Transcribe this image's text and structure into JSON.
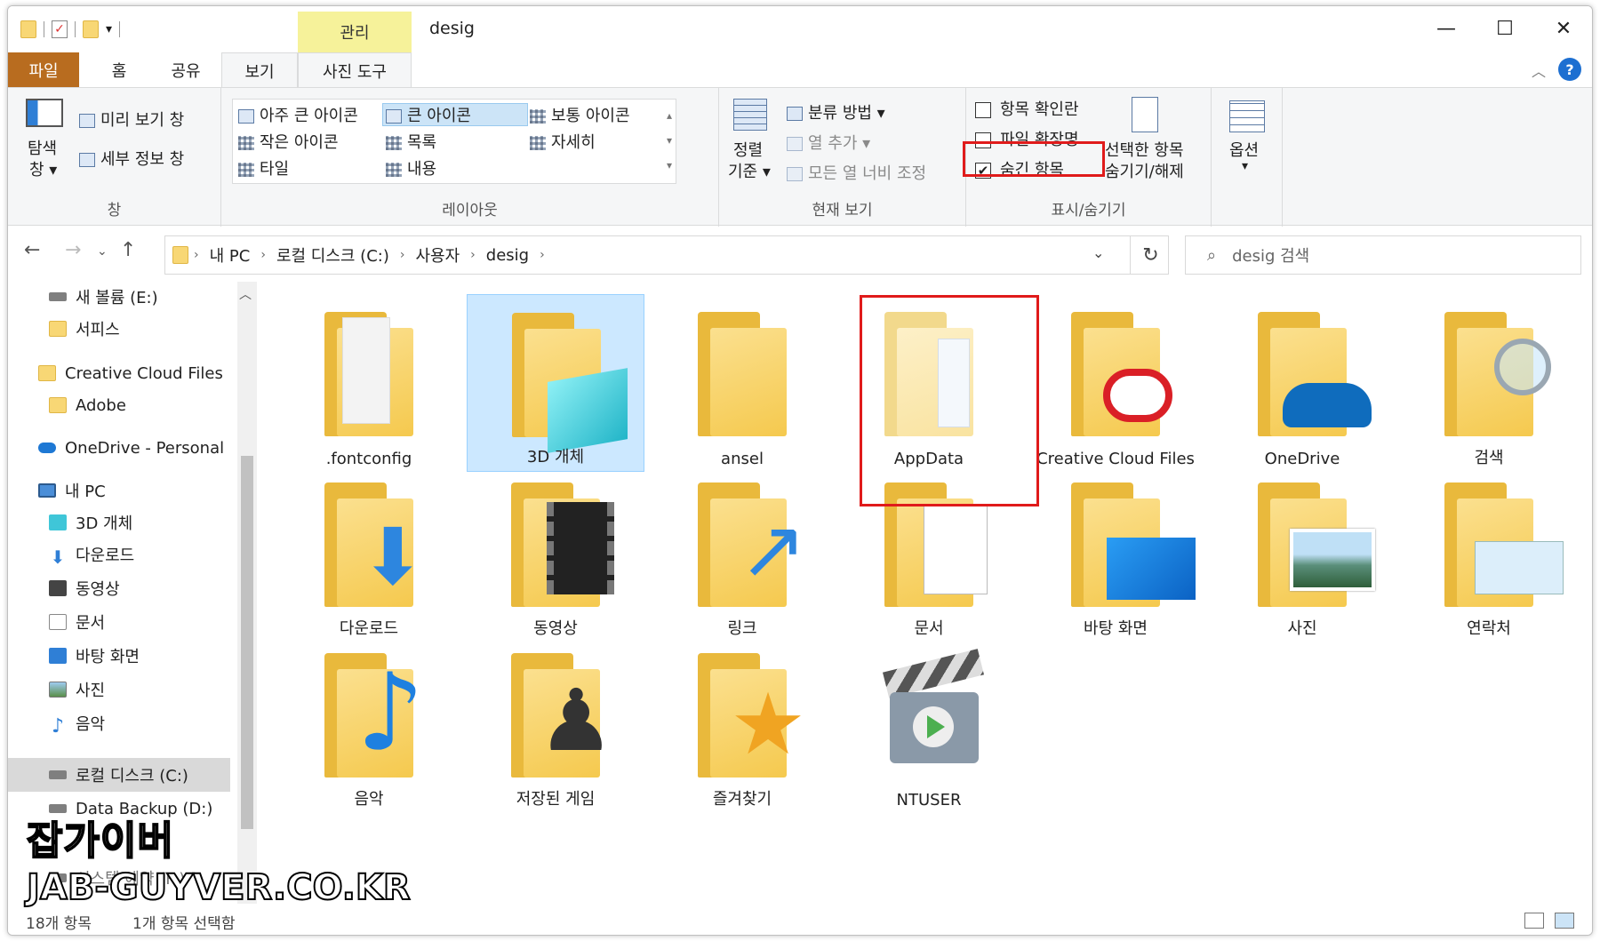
{
  "window": {
    "title": "desig",
    "manage_tab": "관리",
    "minimize": "—",
    "maximize": "☐",
    "close": "✕"
  },
  "tabs": {
    "file": "파일",
    "home": "홈",
    "share": "공유",
    "view": "보기",
    "photo_tools": "사진 도구"
  },
  "ribbon": {
    "pane": {
      "nav_pane": "탐색",
      "nav_pane2": "창 ▾",
      "preview": "미리 보기 창",
      "details": "세부 정보 창",
      "label": "창"
    },
    "layout": {
      "extra_large": "아주 큰 아이콘",
      "large": "큰 아이콘",
      "medium": "보통 아이콘",
      "small": "작은 아이콘",
      "list": "목록",
      "details": "자세히",
      "tiles": "타일",
      "content": "내용",
      "label": "레이아웃"
    },
    "current_view": {
      "sort1": "정렬",
      "sort2": "기준 ▾",
      "group_by": "분류 방법 ▾",
      "add_columns": "열 추가 ▾",
      "size_columns": "모든 열 너비 조정",
      "label": "현재 보기"
    },
    "show_hide": {
      "item_checkboxes": "항목 확인란",
      "file_extensions": "파일 확장명",
      "hidden_items": "숨긴 항목",
      "hide_selected1": "선택한 항목",
      "hide_selected2": "숨기기/해제",
      "label": "표시/숨기기",
      "item_checkboxes_checked": false,
      "file_extensions_checked": false,
      "hidden_items_checked": true
    },
    "options": {
      "label": "옵션",
      "arrow": "▾"
    }
  },
  "address": {
    "crumbs": [
      "내 PC",
      "로컬 디스크 (C:)",
      "사용자",
      "desig"
    ],
    "search_placeholder": "desig 검색"
  },
  "nav": {
    "items": [
      "새 볼륨 (E:)",
      "서피스",
      "Creative Cloud Files",
      "Adobe",
      "OneDrive - Personal",
      "내 PC",
      "3D 개체",
      "다운로드",
      "동영상",
      "문서",
      "바탕 화면",
      "사진",
      "음악",
      "로컬 디스크 (C:)",
      "Data Backup (D:)",
      "시스템 예약 (F:)"
    ]
  },
  "files": [
    ".fontconfig",
    "3D 개체",
    "ansel",
    "AppData",
    "Creative Cloud Files",
    "OneDrive",
    "검색",
    "다운로드",
    "동영상",
    "링크",
    "문서",
    "바탕 화면",
    "사진",
    "연락처",
    "음악",
    "저장된 게임",
    "즐겨찾기",
    "NTUSER"
  ],
  "status": {
    "count": "18개 항목",
    "selected": "1개 항목 선택함"
  },
  "watermark": {
    "line1": "잡가이버",
    "line2": "JAB-GUYVER.CO.KR"
  },
  "colors": {
    "accent": "#b86c1f",
    "selection": "#cce8ff",
    "highlight": "#e01b1b",
    "manage": "#f6f29a"
  }
}
